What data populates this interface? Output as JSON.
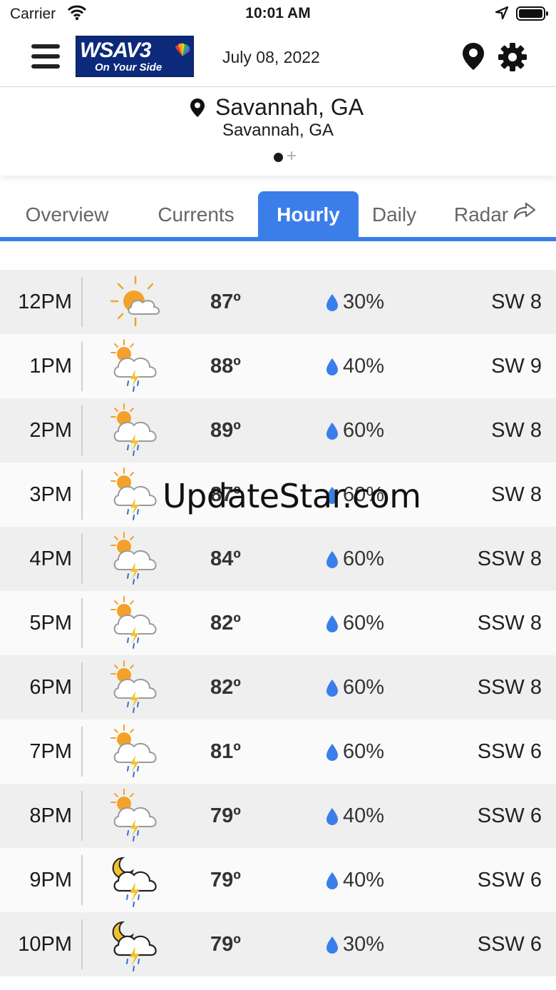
{
  "status_bar": {
    "carrier": "Carrier",
    "time": "10:01 AM"
  },
  "header": {
    "logo_main": "WSAV3",
    "logo_tagline": "On Your Side",
    "date": "July 08, 2022"
  },
  "location": {
    "title": "Savannah, GA",
    "subtitle": "Savannah, GA",
    "add_label": "+"
  },
  "tabs": [
    {
      "label": "Overview",
      "active": false
    },
    {
      "label": "Currents",
      "active": false
    },
    {
      "label": "Hourly",
      "active": true
    },
    {
      "label": "Daily",
      "active": false
    },
    {
      "label": "Radar",
      "active": false
    }
  ],
  "hourly": [
    {
      "time": "12PM",
      "icon": "partly-sunny-icon",
      "temp": "87º",
      "precip": "30%",
      "wind": "SW 8"
    },
    {
      "time": "1PM",
      "icon": "sun-thunderstorm-icon",
      "temp": "88º",
      "precip": "40%",
      "wind": "SW 9"
    },
    {
      "time": "2PM",
      "icon": "sun-thunderstorm-icon",
      "temp": "89º",
      "precip": "60%",
      "wind": "SW 8"
    },
    {
      "time": "3PM",
      "icon": "sun-thunderstorm-icon",
      "temp": "87º",
      "precip": "60%",
      "wind": "SW 8"
    },
    {
      "time": "4PM",
      "icon": "sun-thunderstorm-icon",
      "temp": "84º",
      "precip": "60%",
      "wind": "SSW 8"
    },
    {
      "time": "5PM",
      "icon": "sun-thunderstorm-icon",
      "temp": "82º",
      "precip": "60%",
      "wind": "SSW 8"
    },
    {
      "time": "6PM",
      "icon": "sun-thunderstorm-icon",
      "temp": "82º",
      "precip": "60%",
      "wind": "SSW 8"
    },
    {
      "time": "7PM",
      "icon": "sun-thunderstorm-icon",
      "temp": "81º",
      "precip": "60%",
      "wind": "SSW 6"
    },
    {
      "time": "8PM",
      "icon": "sun-thunderstorm-icon",
      "temp": "79º",
      "precip": "40%",
      "wind": "SSW 6"
    },
    {
      "time": "9PM",
      "icon": "moon-thunderstorm-icon",
      "temp": "79º",
      "precip": "40%",
      "wind": "SSW 6"
    },
    {
      "time": "10PM",
      "icon": "moon-thunderstorm-icon",
      "temp": "79º",
      "precip": "30%",
      "wind": "SSW 6"
    }
  ],
  "watermark": "UpdateStar.com",
  "colors": {
    "accent": "#3b7ee9",
    "drop": "#3b7ee9",
    "sun": "#f4a12a"
  }
}
